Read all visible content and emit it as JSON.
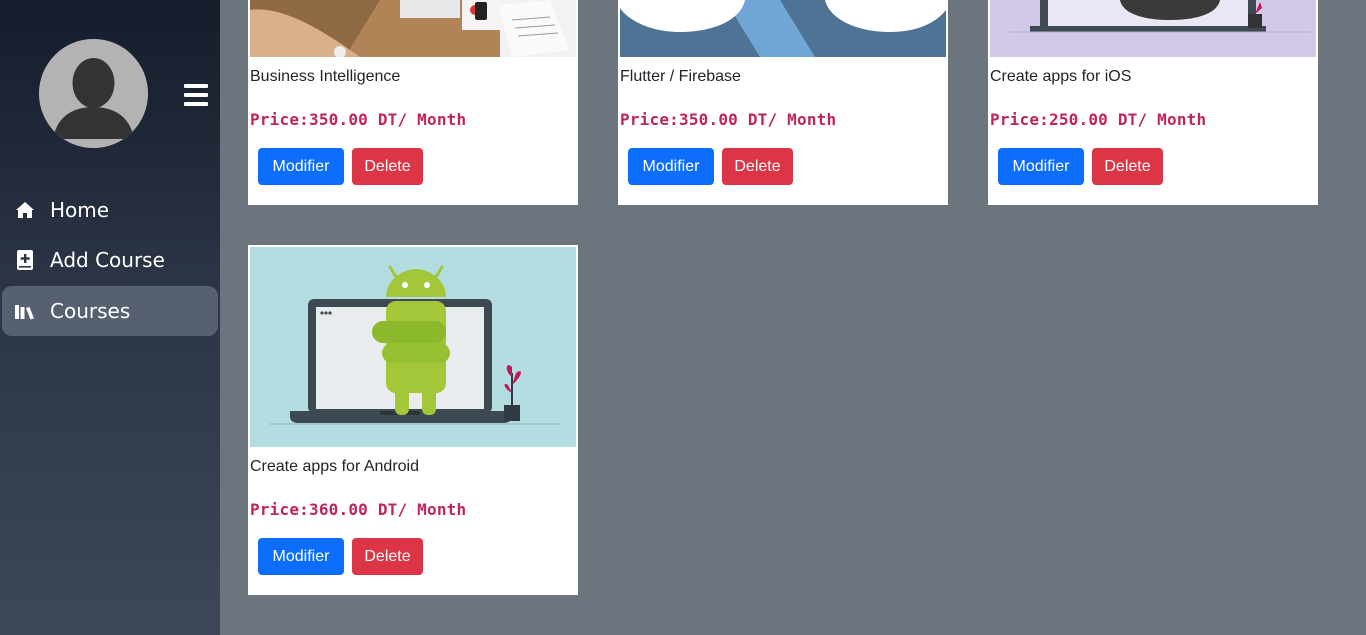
{
  "sidebar": {
    "menu_toggle": "hamburger-icon",
    "items": [
      {
        "label": "Home",
        "icon": "home-icon",
        "active": false
      },
      {
        "label": "Add Course",
        "icon": "book-plus-icon",
        "active": false
      },
      {
        "label": "Courses",
        "icon": "books-icon",
        "active": true
      }
    ]
  },
  "courses": [
    {
      "title": "Business Intelligence",
      "price": "Price:350.00 DT/ Month",
      "edit_label": "Modifier",
      "delete_label": "Delete"
    },
    {
      "title": "Flutter / Firebase",
      "price": "Price:350.00 DT/ Month",
      "edit_label": "Modifier",
      "delete_label": "Delete"
    },
    {
      "title": "Create apps for iOS",
      "price": "Price:250.00 DT/ Month",
      "edit_label": "Modifier",
      "delete_label": "Delete"
    },
    {
      "title": "Create apps for Android",
      "price": "Price:360.00 DT/ Month",
      "edit_label": "Modifier",
      "delete_label": "Delete"
    }
  ],
  "colors": {
    "primary": "#0d6efd",
    "danger": "#dc3545",
    "price": "#c0245e",
    "page_bg": "#6c757d"
  }
}
